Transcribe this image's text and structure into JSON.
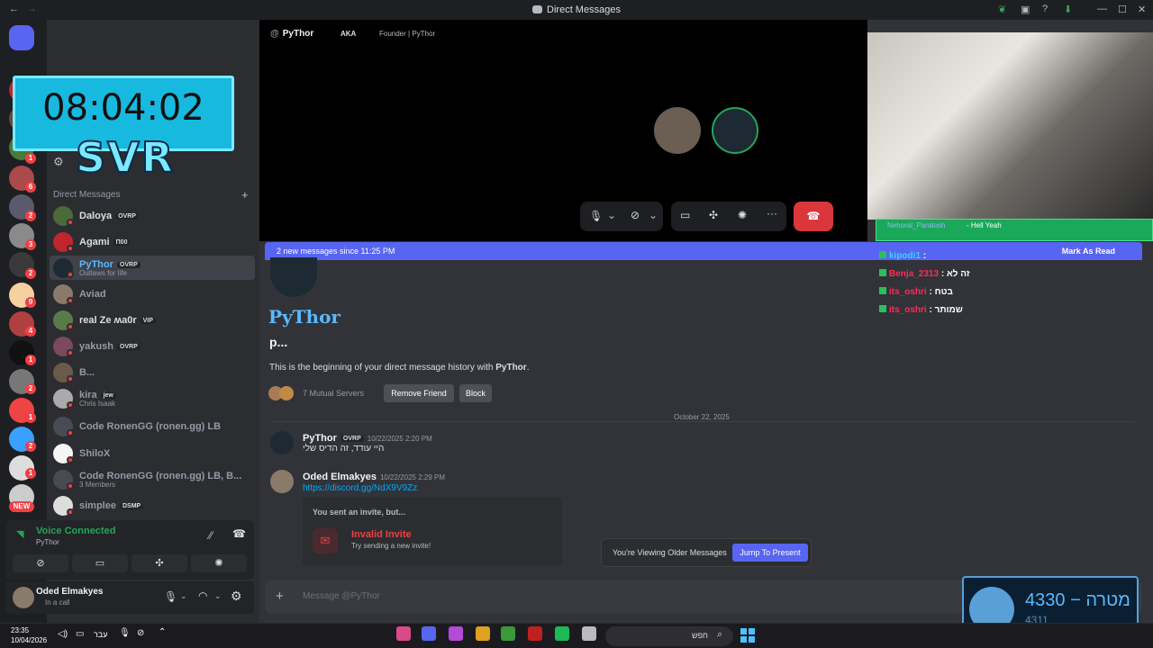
{
  "window": {
    "title": "Direct Messages"
  },
  "overlay_timer": {
    "clock": "08:04:02",
    "label": "SVR"
  },
  "sidebar": {
    "dm_header": "Direct Messages",
    "dms": [
      {
        "name": "Daloya",
        "tag": "OVRP",
        "sub": ""
      },
      {
        "name": "Agami",
        "tag": "Π00",
        "sub": ""
      },
      {
        "name": "PyThor",
        "tag": "OVRP",
        "sub": "Outlaws for life"
      },
      {
        "name": "Aviad",
        "tag": "",
        "sub": ""
      },
      {
        "name": "real Ze ʍa0r",
        "tag": "VIP",
        "sub": ""
      },
      {
        "name": "yakush",
        "tag": "OVRP",
        "sub": ""
      },
      {
        "name": "B...",
        "tag": "",
        "sub": ""
      },
      {
        "name": "kira",
        "tag": "jew",
        "sub": "Chris Isaak"
      },
      {
        "name": "Code RonenGG (ronen.gg) LB",
        "tag": "",
        "sub": ""
      },
      {
        "name": "ShiloX",
        "tag": "",
        "sub": ""
      },
      {
        "name": "Code RonenGG (ronen.gg) LB, B...",
        "tag": "",
        "sub": "3 Members"
      },
      {
        "name": "simplee",
        "tag": "DSMP",
        "sub": ""
      }
    ],
    "guild_badges": [
      "1",
      "6",
      "2",
      "3",
      "2",
      "9",
      "4",
      "1",
      "2",
      "1",
      "2",
      "1",
      "NEW"
    ]
  },
  "voice": {
    "status": "Voice Connected",
    "channel": "PyThor"
  },
  "user": {
    "name": "Oded Elmakyes",
    "status": "In a call"
  },
  "call": {
    "name": "PyThor",
    "aka": "AKA",
    "aka_value": "Founder | PyThor"
  },
  "banner": {
    "text": "2 new messages since 11:25 PM",
    "action": "Mark As Read"
  },
  "profile": {
    "name": "PyThor",
    "username": "p...",
    "intro_pre": "This is the beginning of your direct message history with ",
    "intro_name": "PyThor",
    "intro_post": ".",
    "mutual": "7 Mutual Servers",
    "remove": "Remove Friend",
    "block": "Block"
  },
  "divider": {
    "date": "October 22, 2025"
  },
  "messages": [
    {
      "author": "PyThor",
      "tag": "OVRP",
      "time": "10/22/2025 2:20 PM",
      "text": "היי עודד, זה הדיס שלי"
    },
    {
      "author": "Oded Elmakyes",
      "time": "10/22/2025 2:29 PM",
      "link": "https://discord.gg/NdX9V9Zz"
    }
  ],
  "invite": {
    "heading": "You sent an invite, but...",
    "title": "Invalid Invite",
    "sub": "Try sending a new invite!"
  },
  "older": {
    "text": "You're Viewing Older Messages",
    "button": "Jump To Present"
  },
  "composer": {
    "placeholder": "Message @PyThor"
  },
  "stream_chat": {
    "top": {
      "user": "Nehoral_Paratosh",
      "text": "- Hell Yeah"
    },
    "lines": [
      {
        "user": "kipodi1",
        "sep": " :",
        "text": "",
        "color": "#3ad1ff"
      },
      {
        "user": "Benja_2313",
        "sep": " : ",
        "text": "זה לא",
        "color": "#ff2b5b"
      },
      {
        "user": "its_oshri",
        "sep": " : ",
        "text": "בטח",
        "color": "#ff2b5b"
      },
      {
        "user": "its_oshri",
        "sep": " : ",
        "text": "שמותר",
        "color": "#ff2b5b"
      }
    ]
  },
  "sub_goal": {
    "count": "4330",
    "label": "מטרה",
    "sub": "4311",
    "dash": "−"
  },
  "taskbar": {
    "time": "23:35",
    "date": "10/04/2026",
    "lang": "עבר",
    "search": "חפש"
  }
}
